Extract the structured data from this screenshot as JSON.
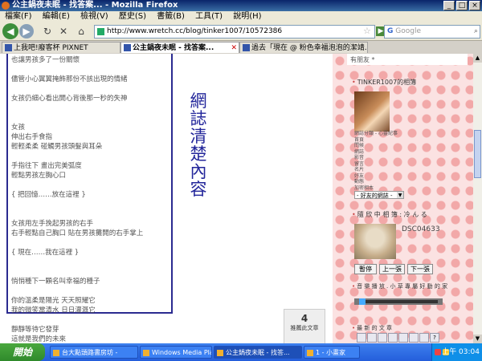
{
  "window": {
    "title": "公主鍋夜未眠 - 找答案... - Mozilla Firefox",
    "controls": [
      "_",
      "□",
      "×"
    ]
  },
  "menu": [
    "檔案(F)",
    "編輯(E)",
    "檢視(V)",
    "歷史(S)",
    "書籤(B)",
    "工具(T)",
    "說明(H)"
  ],
  "nav": {
    "url": "http://www.wretch.cc/blog/tinker1007/10572386",
    "search_placeholder": "Google"
  },
  "tabs": [
    {
      "label": "上我吧!廢客杯 PIXNET",
      "active": false
    },
    {
      "label": "公主鍋夜未眠 - 找答案...",
      "active": true
    },
    {
      "label": "過去「現在 @ 粉色幸福泡泡的潔靖...",
      "active": false
    }
  ],
  "article": {
    "lines": [
      "也讓男孩多了一份關懷",
      "",
      "儘管小心翼翼掩飾那份不該出現的情緒",
      "",
      "女孩仍細心看出開心背後那一秒的失神",
      "",
      "",
      "女孩",
      "伸出右手食指",
      "輕輕柔柔 碰觸男孩頭髮與耳朵",
      "",
      "手指往下 畫出完美弧度",
      "輕點男孩左胸心口",
      "",
      "{ 把回憶……放在這裡 }",
      "",
      "",
      "女孩用左手挽起男孩的右手",
      "右手輕點自己胸口 貼在男孩攤開的右手掌上",
      "",
      "{ 現在……我在這裡 }",
      "",
      "",
      "悄悄種下一顆名叫幸福的種子",
      "",
      "你的溫柔是陽光 天天照耀它",
      "我的微笑當清水 日日灌溉它",
      "",
      "靜靜等待它發芽",
      "這就是我們的未來"
    ],
    "vertical_text": [
      "網",
      "誌",
      "清",
      "楚",
      "內",
      "容"
    ],
    "count_number": "4",
    "count_label": "推薦此文章"
  },
  "sidebar": {
    "friends_text": "有朋友 *",
    "blog_header": "TINKER1007的相簿",
    "links": [
      "網誌分類 - 心靈紀事",
      "首頁",
      "問候",
      "網誌",
      "影音",
      "留言",
      "名片",
      "好友",
      "動態",
      "加密相本"
    ],
    "select_label": "- 好友的網誌 -",
    "album_header": "隨 欣 中 相 簿 : 冷 ん る",
    "photo_label": "DSC04633",
    "buttons": [
      "暫停",
      "上一張",
      "下一張"
    ],
    "music_header": "音 樂 播 放 . 小 草 專 屬 好 動 的 家",
    "recent_header": "最 新 的 文 章"
  },
  "taskbar": {
    "start": "開始",
    "tasks": [
      {
        "label": "台大點頭路書房坊 -",
        "active": false
      },
      {
        "label": "Windows Media Player",
        "active": false
      },
      {
        "label": "公主鍋夜未眠 - 找答...",
        "active": true
      },
      {
        "label": "1 - 小畫家",
        "active": false
      }
    ],
    "clock": "上午 03:04"
  },
  "colors": {
    "accent": "#2b2b90",
    "titlebar": "#0a246a",
    "sidebar_bg": "#fbe2e2",
    "taskbar": "#245edb"
  }
}
